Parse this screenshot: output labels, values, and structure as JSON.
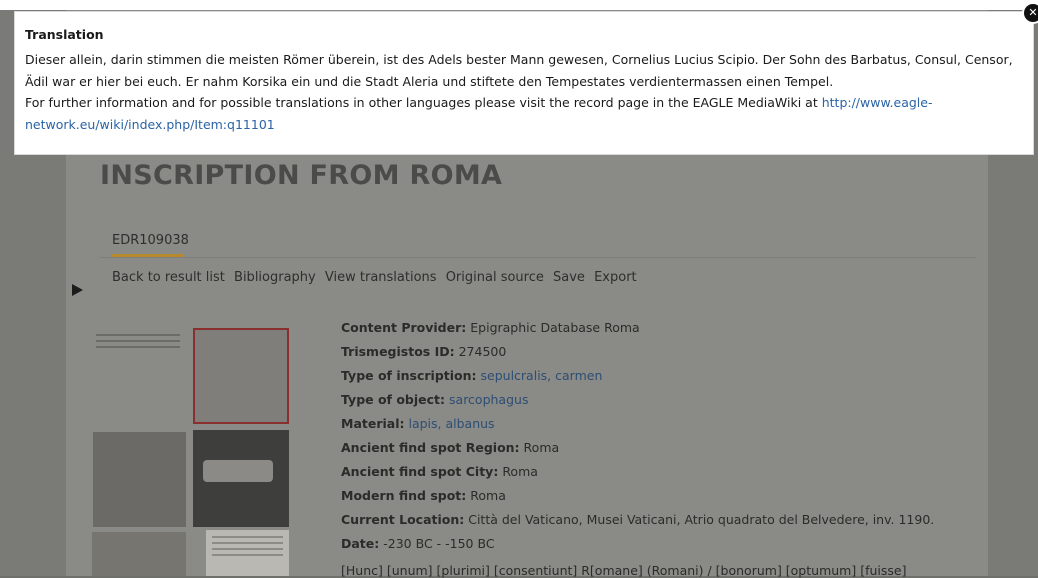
{
  "modal": {
    "title": "Translation",
    "text_de": "Dieser allein, darin stimmen die meisten Römer überein, ist des Adels bester Mann gewesen, Cornelius Lucius Scipio. Der Sohn des Barbatus, Consul, Censor, Ädil war er hier bei euch. Er nahm Korsika ein und die Stadt Aleria und stiftete den Tempestates verdientermassen einen Tempel.",
    "info_prefix": "For further information and for possible translations in other languages please visit the record page in the EAGLE MediaWiki at ",
    "link_text": "http://www.eagle-network.eu/wiki/index.php/Item:q11101",
    "close_icon": "✕"
  },
  "page": {
    "title": "INSCRIPTION FROM ROMA",
    "record_id": "EDR109038",
    "nav": [
      "Back to result list",
      "Bibliography",
      "View translations",
      "Original source",
      "Save",
      "Export"
    ]
  },
  "metadata": [
    {
      "label": "Content Provider:",
      "value": "Epigraphic Database Roma",
      "link": false
    },
    {
      "label": "Trismegistos ID:",
      "value": "274500",
      "link": false
    },
    {
      "label": "Type of inscription:",
      "value": "sepulcralis, carmen",
      "link": true
    },
    {
      "label": "Type of object:",
      "value": "sarcophagus",
      "link": true
    },
    {
      "label": "Material:",
      "value": "lapis, albanus",
      "link": true
    },
    {
      "label": "Ancient find spot Region:",
      "value": "Roma",
      "link": false
    },
    {
      "label": "Ancient find spot City:",
      "value": "Roma",
      "link": false
    },
    {
      "label": "Modern find spot:",
      "value": "Roma",
      "link": false
    },
    {
      "label": "Current Location:",
      "value": "Città del Vaticano, Musei Vaticani, Atrio quadrato del Belvedere, inv. 1190.",
      "link": false
    },
    {
      "label": "Date:",
      "value": "-230 BC - -150 BC",
      "link": false
    }
  ],
  "inscription_text_partial": "[Hunc] [unum] [plurimi] [consentiunt] R[omane] (Romani) / [bonorum] [optumum] [fuisse]",
  "colors": {
    "accent": "#b88a2d",
    "link": "#2a63a6",
    "overlay": "#6f6f6c"
  }
}
